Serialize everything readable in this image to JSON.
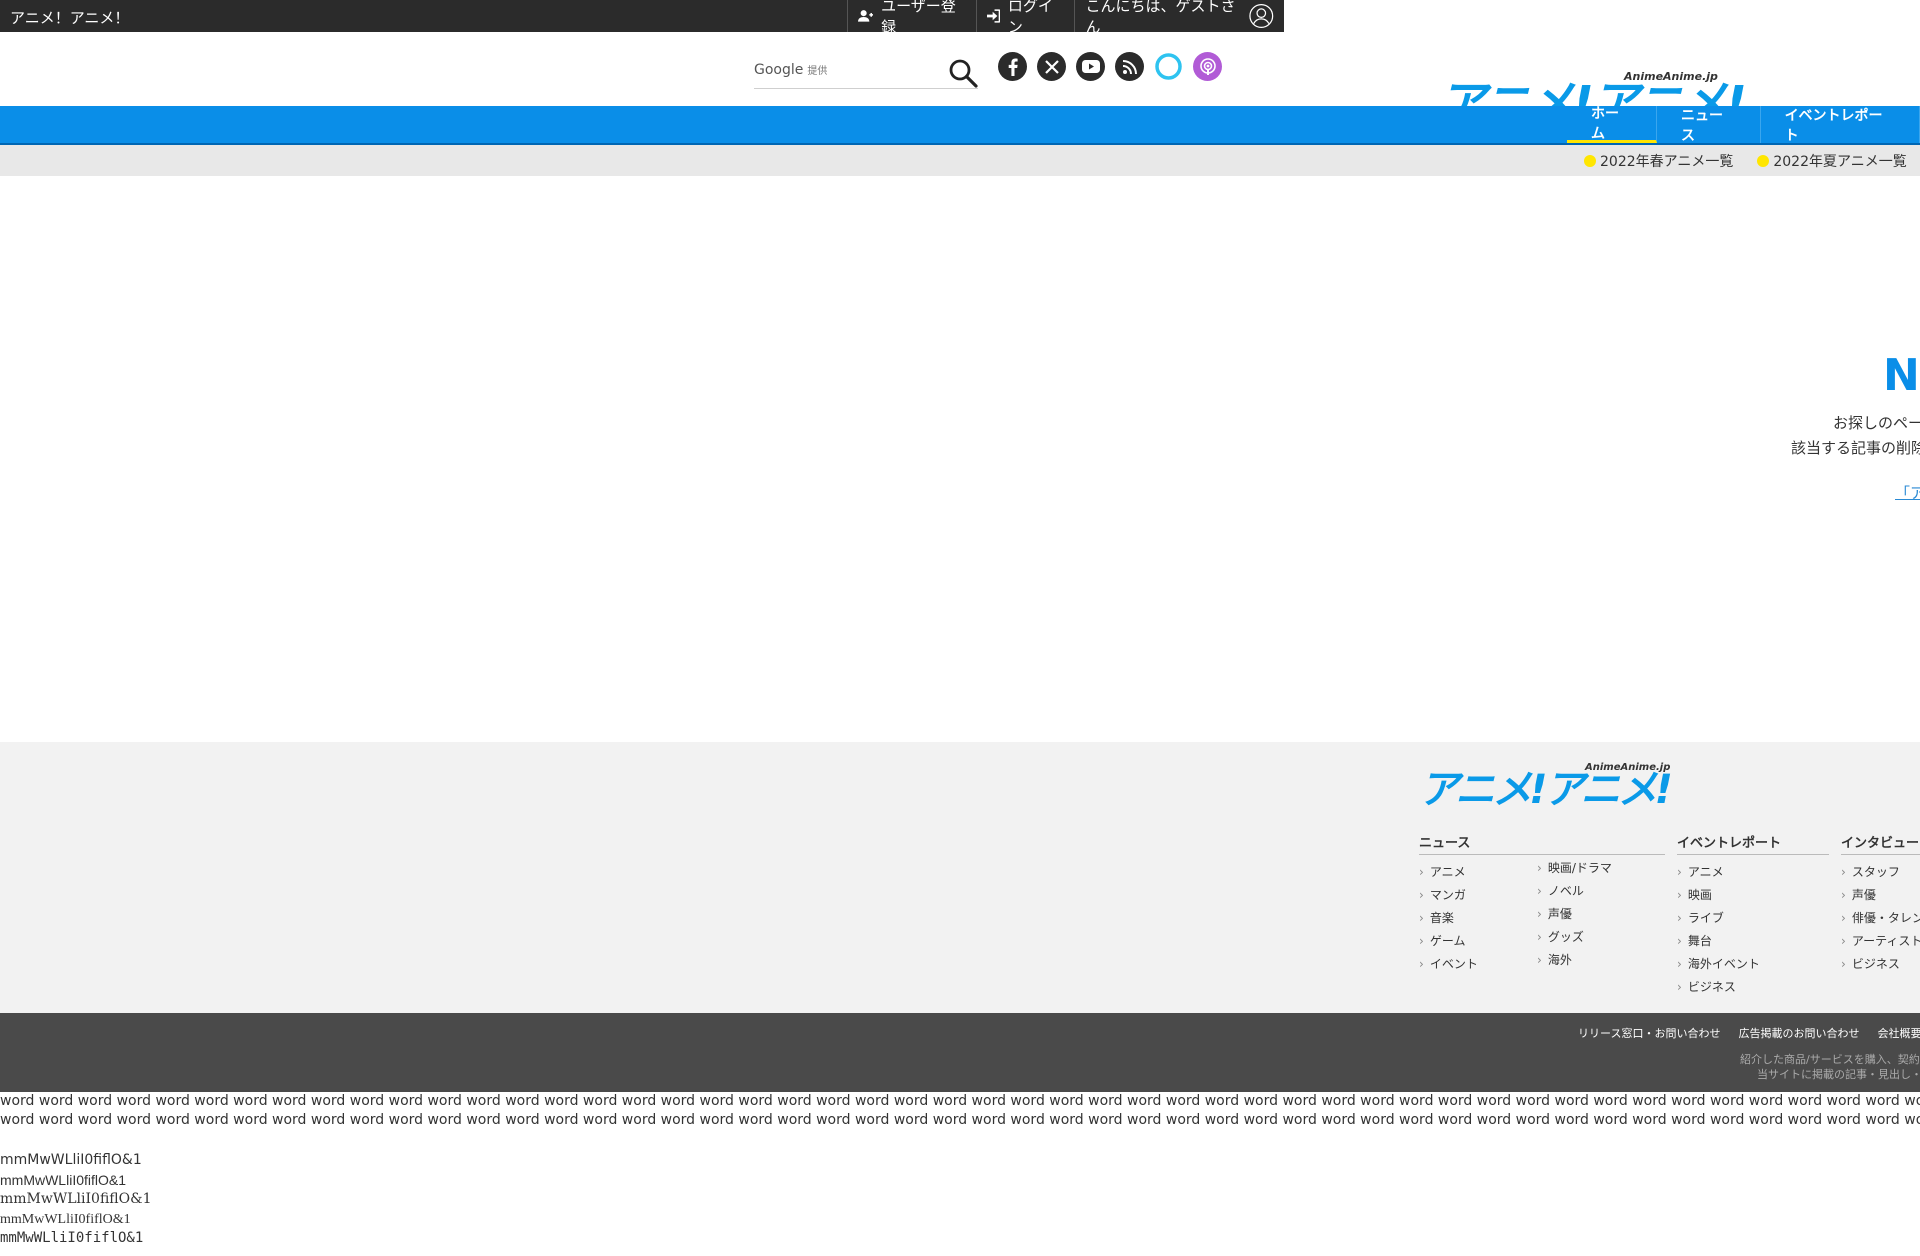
{
  "topbar": {
    "site_name": "アニメ！アニメ！",
    "register": "ユーザー登録",
    "login": "ログイン",
    "greeting": "こんにちは、ゲストさん"
  },
  "header": {
    "search_provider": "Google",
    "search_provider_suffix": "提供",
    "logo_small": "AnimeAnime.jp",
    "logo_text": "アニメ!アニメ!",
    "logo_tag": "iid",
    "socials": [
      "facebook-icon",
      "x-icon",
      "youtube-icon",
      "rss-icon",
      "alexa-icon",
      "podcast-icon"
    ]
  },
  "nav": {
    "items": [
      "ホーム",
      "ニュース",
      "イベントレポート"
    ],
    "active_index": 0
  },
  "seasons": [
    "2022年春アニメ一覧",
    "2022年夏アニメ一覧"
  ],
  "not_found": {
    "title": "N",
    "msg1": "お探しのペー",
    "msg2": "該当する記事の削除",
    "link": "「ア"
  },
  "footer": {
    "logo_small": "AnimeAnime.jp",
    "logo_text": "アニメ!アニメ!",
    "columns": [
      {
        "title": "ニュース",
        "items": [
          "アニメ",
          "マンガ",
          "音楽",
          "ゲーム",
          "イベント"
        ]
      },
      {
        "title": "",
        "items": [
          "映画/ドラマ",
          "ノベル",
          "声優",
          "グッズ",
          "海外"
        ]
      },
      {
        "title": "イベントレポート",
        "items": [
          "アニメ",
          "映画",
          "ライブ",
          "舞台",
          "海外イベント",
          "ビジネス"
        ]
      },
      {
        "title": "インタビュー",
        "items": [
          "スタッフ",
          "声優",
          "俳優・タレン",
          "アーティスト",
          "ビジネス"
        ]
      }
    ],
    "links": [
      "リリース窓口・お問い合わせ",
      "広告掲載のお問い合わせ",
      "会社概要"
    ],
    "note1": "紹介した商品/サービスを購入、契約",
    "note2": "当サイトに掲載の記事・見出し・"
  },
  "test": {
    "line1": "word word word word word word word word word word word word word word word word word word word word word word word word word word word word word word word word word word word word word word word word word word word word word word word word word word word word word word word word word word word word word word word word word word",
    "line2": "word word word word word word word word word word word word word word word word word word word word word word word word word word word word word word word word word word word word word word word word word word word word word word word word word word word word word word word word word word word word word word word word word word word",
    "font_sample": "mmMwWLliI0fiflO&1"
  },
  "colors": {
    "brand_blue": "#0a8ee8",
    "accent_yellow": "#ffe400",
    "topbar_bg": "#2b2b2b"
  }
}
